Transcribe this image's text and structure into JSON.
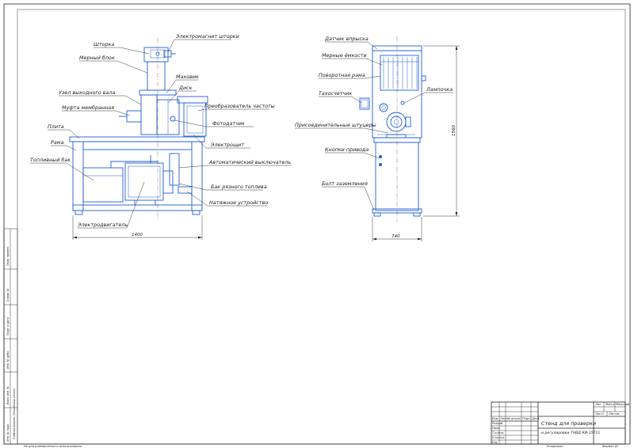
{
  "front_labels": [
    "Шторка",
    "Электромагнит шторки",
    "Мерный блок",
    "Маховик",
    "Диск",
    "Узел выходного вала",
    "Муфта мембранная",
    "Преобразователь частоты",
    "Фотодатчик",
    "Плита",
    "Рама",
    "Электрощит",
    "Топливный бак",
    "Автоматический выключатель",
    "Бак рязного топлива",
    "Натяжное устройство",
    "Электродвигатель"
  ],
  "side_labels": [
    "Датчик впрыска",
    "Мерные ёмкости",
    "Поворотная рама",
    "Тахосчетчик",
    "Лампочка",
    "Присоединительные штуцеры",
    "Кнопки привода",
    "Болт заземления"
  ],
  "dimensions": {
    "front_width": "1400",
    "side_width": "740",
    "side_height": "1560"
  },
  "title_block": {
    "title_line1": "Стенд для проверки",
    "title_line2": "и регулировки ТНВД КИ-15711",
    "col_izm": "Изм.",
    "col_list": "Лист",
    "col_doc": "№ докум.",
    "col_sign": "Подп.",
    "col_date": "Дата",
    "row_razrab": "Разраб.",
    "row_prov": "Пров.",
    "row_tkontr": "Т.контр.",
    "row_nkontr": "Н.контр.",
    "row_utv": "Утв.",
    "lit": "Лит.",
    "mass": "Масса",
    "scale": "Масштаб",
    "sheet": "Лист",
    "sheets": "Листов",
    "sheet_num": "1",
    "copied": "Копировал",
    "format": "Формат A1"
  },
  "side_strip": {
    "perv_primen": "Перв. примен.",
    "sprav": "Справ. №",
    "podp_data": "Подп. и дата",
    "inv_dubl": "Инв. № дубл.",
    "vzam_inv": "Взам. инв. №",
    "inv_podl": "Инв. № подл.",
    "author": "Учебная версия / Educational version"
  },
  "bottom_note": "Не для коммерческого использования"
}
